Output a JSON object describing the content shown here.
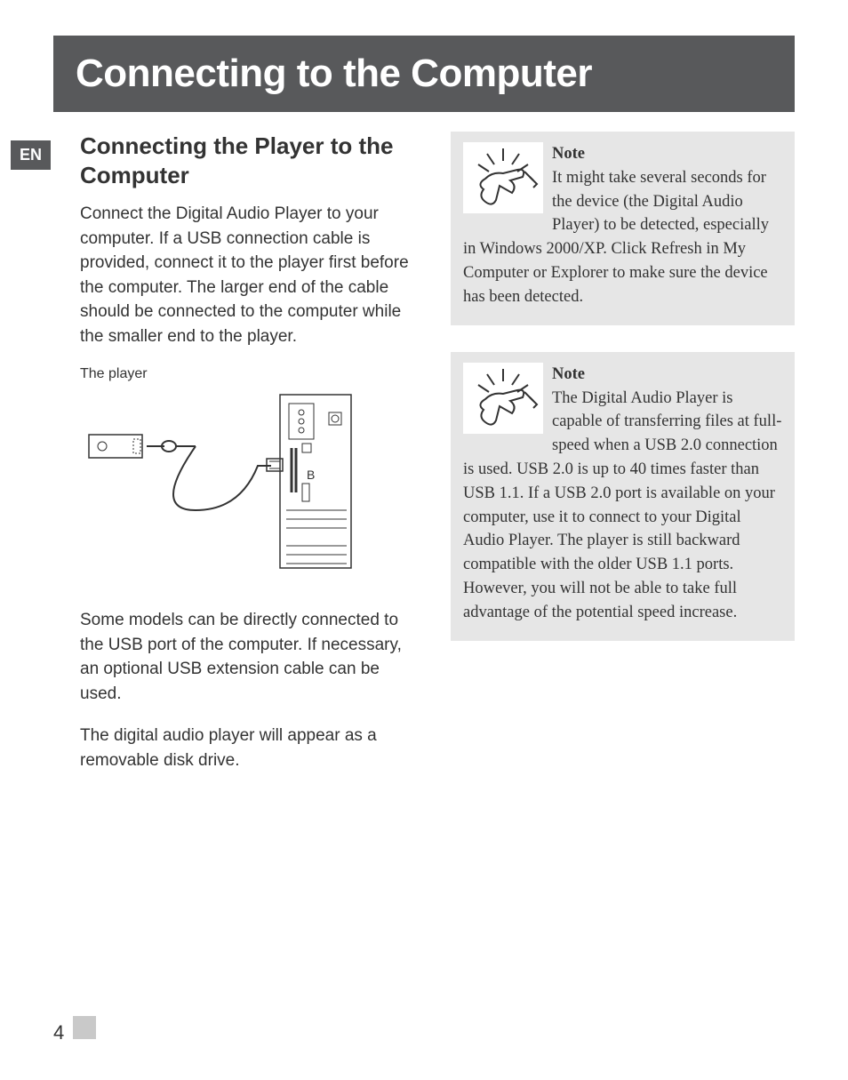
{
  "title": "Connecting to the Computer",
  "lang_badge": "EN",
  "section_heading": "Connecting the Player to the Computer",
  "left": {
    "para1": "Connect the Digital Audio Player to your computer. If a USB connection cable is provided, connect it to the player first before the computer. The larger end of the cable should be connected to the computer while the smaller end to the player.",
    "diagram_label": "The player",
    "para2": "Some models can be directly connected to the USB port of the computer. If necessary, an optional USB extension cable can be used.",
    "para3": "The digital audio player will appear as a removable disk drive."
  },
  "notes": [
    {
      "title": "Note",
      "body": "It might take several seconds for the device (the Digital Audio Player) to be detected, especially in Windows 2000/XP. Click Refresh in My Computer or Explorer to make sure the device has been detected."
    },
    {
      "title": "Note",
      "body": "The Digital Audio Player is capable of transferring files at full-speed when a USB 2.0 connection is used. USB 2.0 is up to 40 times faster than USB 1.1. If a USB 2.0 port is available on your computer, use it to connect to your Digital Audio Player. The player is still backward compatible with the older USB 1.1 ports. However, you will not be able to take full advantage of the potential speed increase."
    }
  ],
  "page_number": "4"
}
